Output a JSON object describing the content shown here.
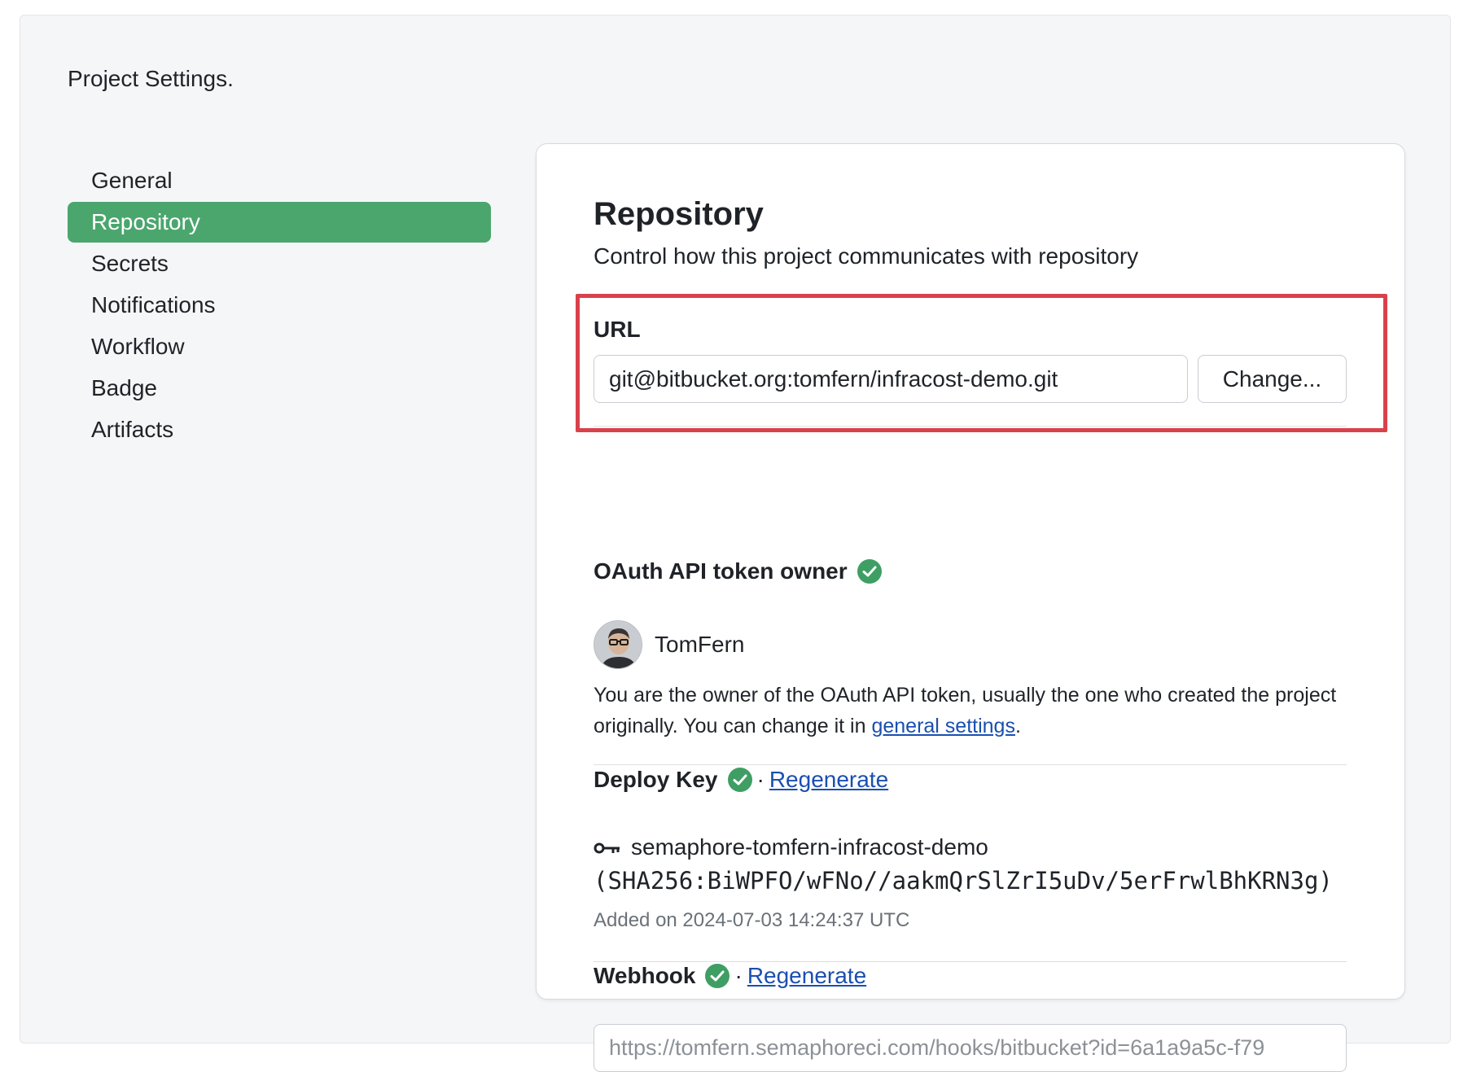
{
  "page": {
    "title": "Project Settings."
  },
  "sidebar": {
    "items": [
      {
        "label": "General",
        "active": false
      },
      {
        "label": "Repository",
        "active": true
      },
      {
        "label": "Secrets",
        "active": false
      },
      {
        "label": "Notifications",
        "active": false
      },
      {
        "label": "Workflow",
        "active": false
      },
      {
        "label": "Badge",
        "active": false
      },
      {
        "label": "Artifacts",
        "active": false
      }
    ]
  },
  "repository": {
    "title": "Repository",
    "subtitle": "Control how this project communicates with repository",
    "url": {
      "label": "URL",
      "value": "git@bitbucket.org:tomfern/infracost-demo.git",
      "change_label": "Change..."
    },
    "oauth": {
      "label": "OAuth API token owner",
      "owner_name": "TomFern",
      "desc_before": "You are the owner of the OAuth API token, usually the one who created the project originally. You can change it in ",
      "desc_link": "general settings",
      "desc_after": "."
    },
    "deploy_key": {
      "label": "Deploy Key",
      "separator": "·",
      "regenerate_label": "Regenerate",
      "key_name": "semaphore-tomfern-infracost-demo",
      "fingerprint": "(SHA256:BiWPFO/wFNo//aakmQrSlZrI5uDv/5erFrwlBhKRN3g)",
      "added_on": "Added on 2024-07-03 14:24:37 UTC"
    },
    "webhook": {
      "label": "Webhook",
      "separator": "·",
      "regenerate_label": "Regenerate",
      "url": "https://tomfern.semaphoreci.com/hooks/bitbucket?id=6a1a9a5c-f79"
    }
  },
  "colors": {
    "accent_green": "#4aa66d",
    "check_green": "#3f9e64",
    "highlight_red": "#d9414b",
    "link_blue": "#1a4fb0"
  },
  "icons": {
    "status": "check-circle-icon",
    "key": "key-icon",
    "avatar": "avatar"
  }
}
